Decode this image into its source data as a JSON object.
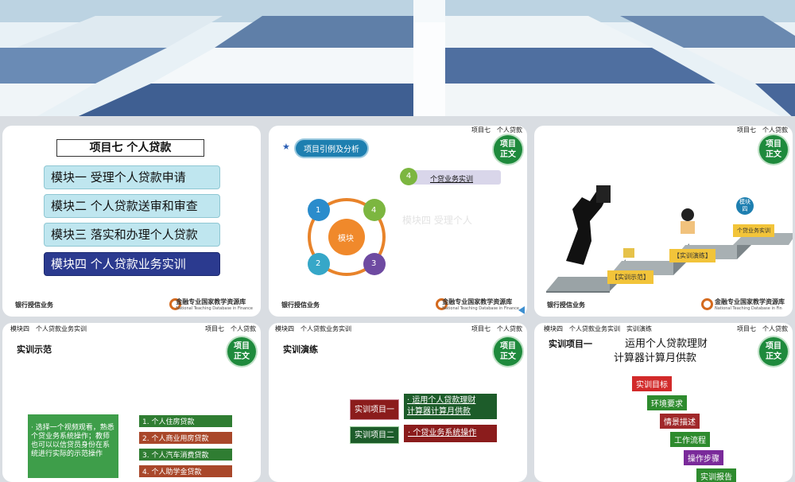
{
  "slides": {
    "s1": {
      "title": "项目七 个人贷款",
      "modules": [
        "模块一 受理个人贷款申请",
        "模块二 个人贷款送审和审查",
        "模块三 落实和办理个人贷款",
        "模块四 个人贷款业务实训"
      ],
      "footer_left": "银行授信业务",
      "footer_right": "金融专业国家教学资源库",
      "footer_right_en": "National Teaching Database in Finance",
      "tdf": "TDF"
    },
    "s2": {
      "header": "项目七　个人贷款",
      "star": "★",
      "pill": "项目引例及分析",
      "badge_l1": "项目",
      "badge_l2": "正文",
      "item_num": "4",
      "item_label": "个贷业务实训",
      "center": "模块",
      "n1": "1",
      "n2": "2",
      "n3": "3",
      "n4": "4",
      "faded": "模块四  受理个人",
      "footer_left": "银行授信业务",
      "footer_right": "金融专业国家教学资源库",
      "footer_right_en": "National Teaching Database in Finance",
      "tdf": "TDF"
    },
    "s3": {
      "header": "项目七　个人贷款",
      "badge_l1": "项目",
      "badge_l2": "正文",
      "module_badge_l1": "模块",
      "module_badge_l2": "四",
      "step1": "【实训示范】",
      "step2": "【实训演练】",
      "step3": "个贷业务实训",
      "footer_left": "银行授信业务",
      "footer_right": "金融专业国家教学资源库",
      "footer_right_en": "National Teaching Database in Fin",
      "tdf": "TDF"
    },
    "s4": {
      "header_left": "模块四　个人贷款业务实训",
      "header_right": "项目七　个人贷款",
      "title": "实训示范",
      "badge_l1": "项目",
      "badge_l2": "正文",
      "desc": "· 选择一个视频观看，熟悉个贷业务系统操作；教师也可以以信贷员身份在系统进行实际的示范操作",
      "items": [
        "1. 个人住房贷款",
        "2. 个人商业用房贷款",
        "3. 个人汽车消费贷款",
        "4. 个人助学金贷款"
      ]
    },
    "s5": {
      "header_left": "模块四　个人贷款业务实训",
      "header_right": "项目七　个人贷款",
      "title": "实训演练",
      "badge_l1": "项目",
      "badge_l2": "正文",
      "p1_label": "实训项目一",
      "p1_desc_l1": "· 运用个人贷款理财",
      "p1_desc_l2": "计算器计算月供款",
      "p2_label": "实训项目二",
      "p2_desc": "· 个贷业务系统操作"
    },
    "s6": {
      "header_left": "模块四　个人贷款业务实训　实训演练",
      "header_right": "项目七　个人贷款",
      "title_left": "实训项目一",
      "title_l1": "运用个人贷款理财",
      "title_l2": "计算器计算月供款",
      "badge_l1": "项目",
      "badge_l2": "正文",
      "steps": [
        "实训目标",
        "环境要求",
        "情景描述",
        "工作流程",
        "操作步骤",
        "实训报告"
      ]
    }
  }
}
